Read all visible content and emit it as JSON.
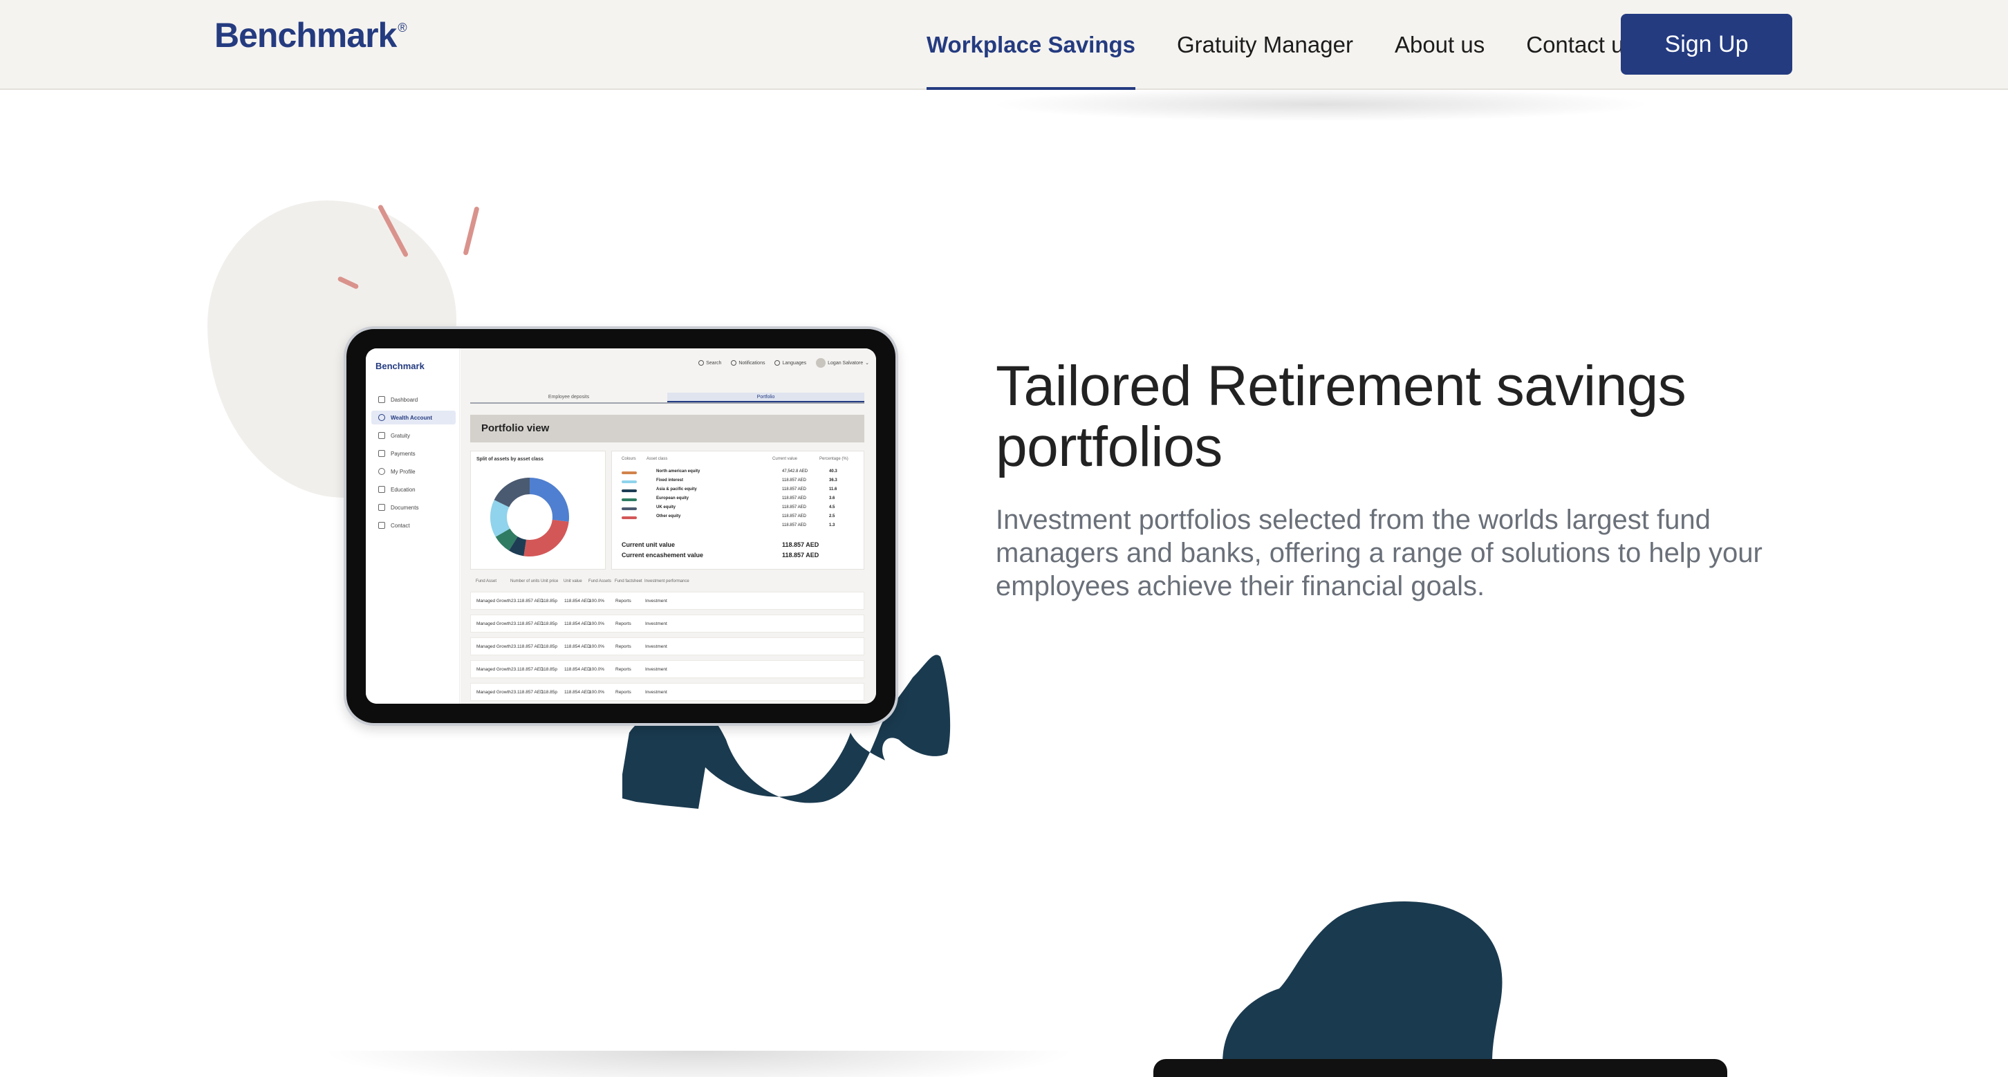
{
  "header": {
    "logo": "Benchmark",
    "logo_mark": "®",
    "nav": [
      "Workplace Savings",
      "Gratuity Manager",
      "About us",
      "Contact us"
    ],
    "signup": "Sign Up"
  },
  "hero": {
    "title": "Tailored Retirement savings portfolios",
    "subtitle": "Investment portfolios selected from the worlds largest fund managers and banks, offering a range of solutions to help your employees achieve their financial goals."
  },
  "app": {
    "logo": "Benchmark",
    "sidebar": [
      "Dashboard",
      "Wealth Account",
      "Gratuity",
      "Payments",
      "My Profile",
      "Education",
      "Documents",
      "Contact"
    ],
    "topbar": [
      "Search",
      "Notifications",
      "Languages",
      "Logan Salvatore"
    ],
    "tabs": [
      "Employee deposits",
      "Portfolio"
    ],
    "section_title": "Portfolio view",
    "donut_title": "Split of assets by asset class",
    "legend_headers": [
      "Colours",
      "Asset class",
      "Current value",
      "Percentage (%)"
    ],
    "assets": [
      {
        "name": "North american equity",
        "value": "47,542.8 AED",
        "pct": "40.3",
        "color": "#d2834a"
      },
      {
        "name": "Fixed interest",
        "value": "118.857 AED",
        "pct": "36.3",
        "color": "#8fd3ec"
      },
      {
        "name": "Asia & pacific equity",
        "value": "118.857 AED",
        "pct": "11.6",
        "color": "#1e3d55"
      },
      {
        "name": "European equity",
        "value": "118.857 AED",
        "pct": "3.6",
        "color": "#2f7c62"
      },
      {
        "name": "UK equity",
        "value": "118.857 AED",
        "pct": "4.5",
        "color": "#4a5a70"
      },
      {
        "name": "Other equity",
        "value": "118.857 AED",
        "pct": "2.5",
        "color": "#d45757"
      },
      {
        "name": "",
        "value": "118.857 AED",
        "pct": "1.3",
        "color": "#ffffff"
      }
    ],
    "totals": [
      {
        "label": "Current unit value",
        "value": "118.857 AED"
      },
      {
        "label": "Current encashement value",
        "value": "118.857 AED"
      }
    ],
    "table_headers": [
      "Fund Asset",
      "Number of units",
      "Unit price",
      "Unit value",
      "Fund Assets",
      "Fund factsheet",
      "Investment performance"
    ],
    "rows": [
      [
        "Managed Growth",
        "23.118.857 AED",
        "118.85p",
        "118.854 AED",
        "100.0%",
        "Reports",
        "Investment"
      ],
      [
        "Managed Growth",
        "23.118.857 AED",
        "118.85p",
        "118.854 AED",
        "100.0%",
        "Reports",
        "Investment"
      ],
      [
        "Managed Growth",
        "23.118.857 AED",
        "118.85p",
        "118.854 AED",
        "100.0%",
        "Reports",
        "Investment"
      ],
      [
        "Managed Growth",
        "23.118.857 AED",
        "118.85p",
        "118.854 AED",
        "100.0%",
        "Reports",
        "Investment"
      ],
      [
        "Managed Growth",
        "23.118.857 AED",
        "118.85p",
        "118.854 AED",
        "100.0%",
        "Reports",
        "Investment"
      ]
    ]
  },
  "colors": {
    "brand": "#243b80",
    "dark_blob": "#1a3a4f",
    "accent_dash": "#d9938c"
  }
}
